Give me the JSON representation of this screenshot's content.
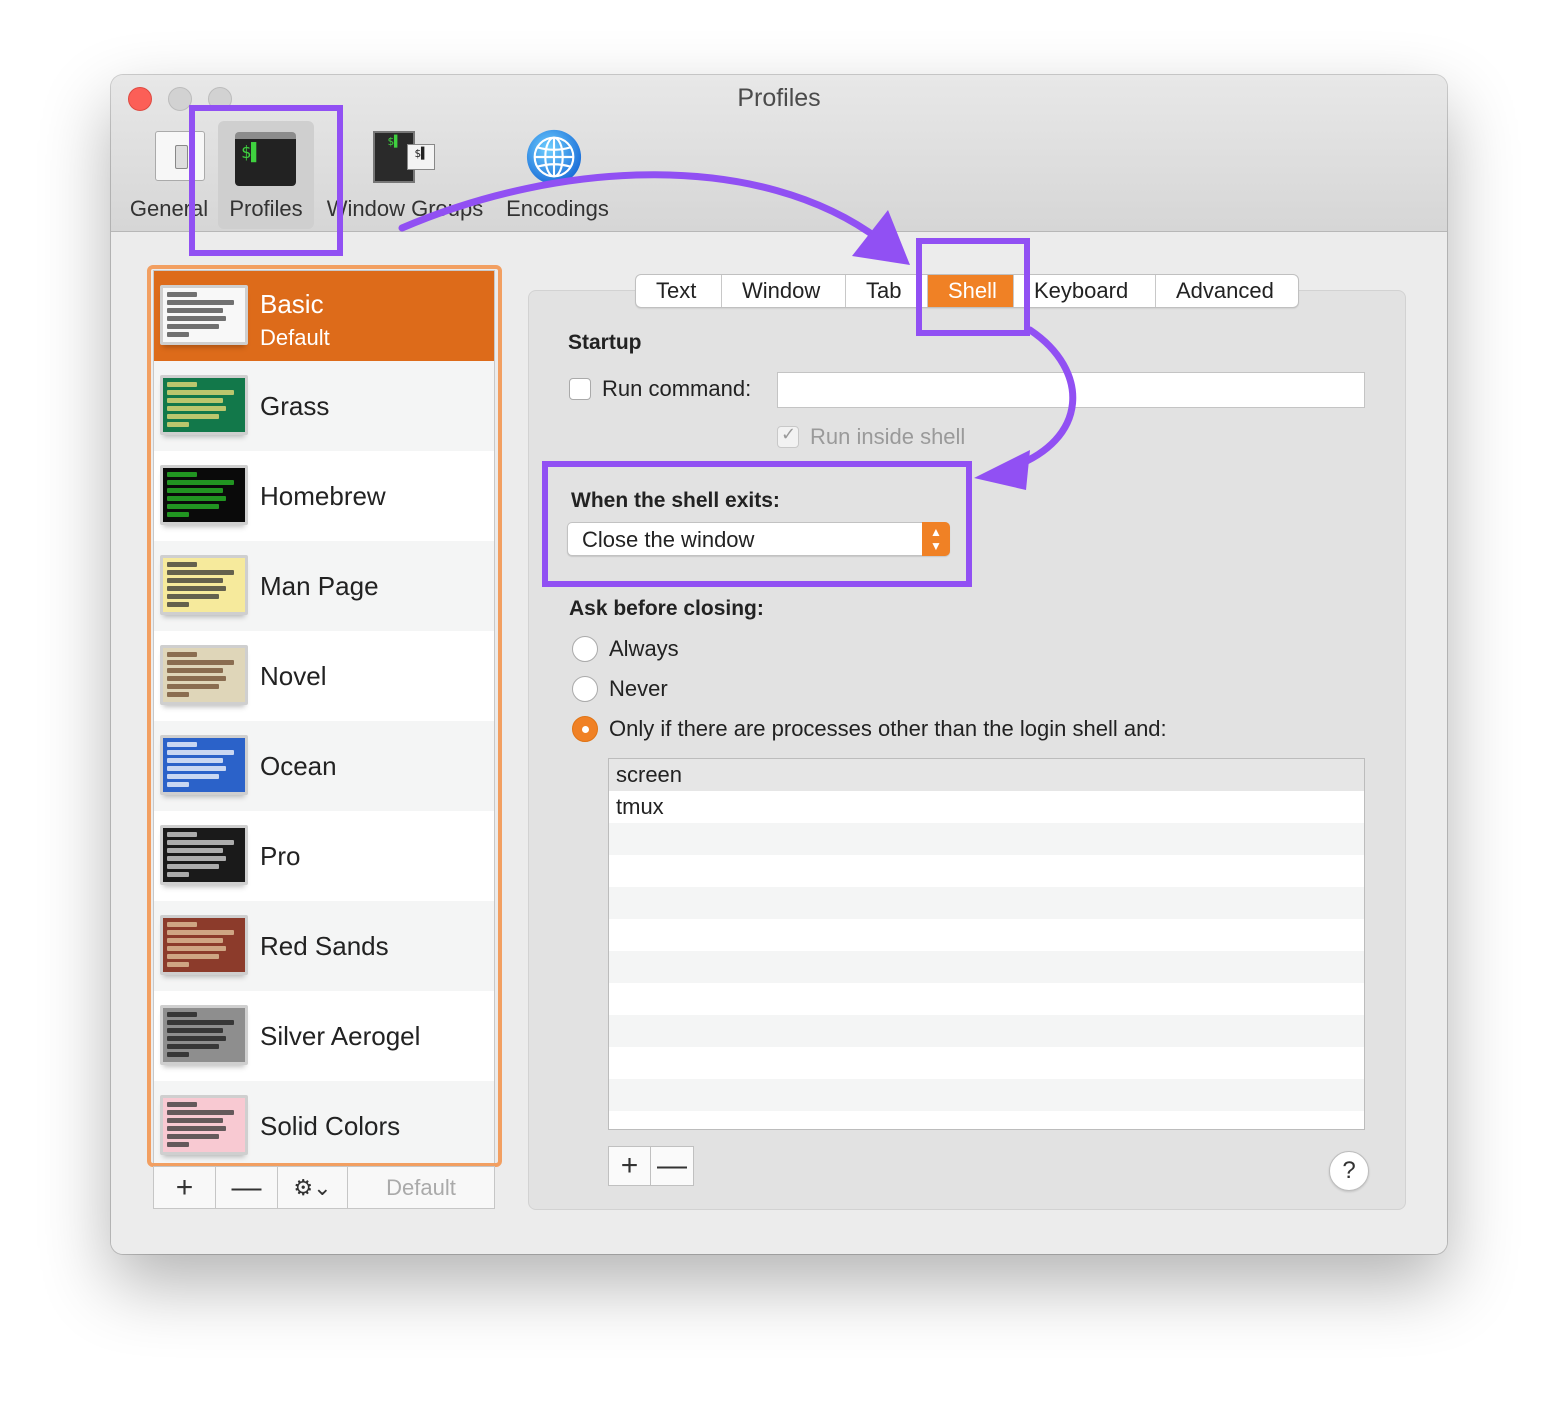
{
  "window": {
    "title": "Profiles"
  },
  "toolbar": {
    "general": "General",
    "profiles": "Profiles",
    "window_groups": "Window Groups",
    "encodings": "Encodings"
  },
  "profiles": [
    {
      "name": "Basic",
      "sub": "Default",
      "thumb_bg": "#f8f8f8",
      "thumb_line": "#444444",
      "selected": true
    },
    {
      "name": "Grass",
      "thumb_bg": "#12784a",
      "thumb_line": "#f3e07a"
    },
    {
      "name": "Homebrew",
      "thumb_bg": "#0a0a0a",
      "thumb_line": "#29c329"
    },
    {
      "name": "Man Page",
      "thumb_bg": "#f6ea9c",
      "thumb_line": "#333333"
    },
    {
      "name": "Novel",
      "thumb_bg": "#dfd6b9",
      "thumb_line": "#6e4a2e"
    },
    {
      "name": "Ocean",
      "thumb_bg": "#2b62c9",
      "thumb_line": "#ffffff"
    },
    {
      "name": "Pro",
      "thumb_bg": "#1a1a1a",
      "thumb_line": "#dddddd"
    },
    {
      "name": "Red Sands",
      "thumb_bg": "#8c3b2b",
      "thumb_line": "#e6c9a1"
    },
    {
      "name": "Silver Aerogel",
      "thumb_bg": "#8e8e8e",
      "thumb_line": "#1a1a1a"
    },
    {
      "name": "Solid Colors",
      "thumb_bg": "#f8c9d2",
      "thumb_line": "#333333"
    }
  ],
  "list_buttons": {
    "add": "+",
    "remove": "—",
    "gear": "⚙⌄",
    "default": "Default"
  },
  "tabs": [
    "Text",
    "Window",
    "Tab",
    "Shell",
    "Keyboard",
    "Advanced"
  ],
  "active_tab": "Shell",
  "shell": {
    "startup_heading": "Startup",
    "run_command_label": "Run command:",
    "run_command_value": "",
    "run_inside_shell_label": "Run inside shell",
    "exits_heading": "When the shell exits:",
    "exits_value": "Close the window",
    "ask_heading": "Ask before closing:",
    "ask_options": [
      "Always",
      "Never",
      "Only if there are processes other than the login shell and:"
    ],
    "ask_selected": 2,
    "processes": [
      "screen",
      "tmux"
    ],
    "proc_add": "+",
    "proc_remove": "—",
    "help": "?"
  },
  "colors": {
    "accent": "#f08125",
    "selection": "#dd6b1a",
    "annotation": "#9150f3",
    "list_border": "#f29f61"
  }
}
